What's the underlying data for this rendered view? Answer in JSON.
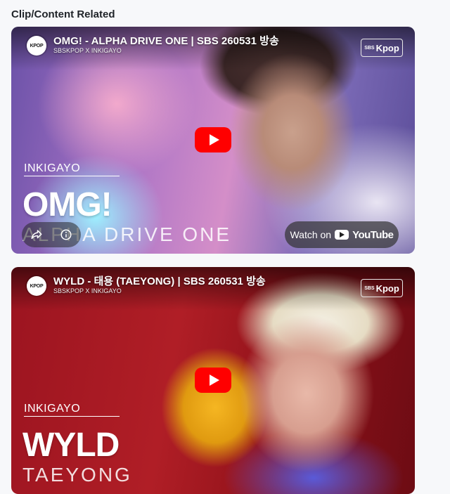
{
  "section": {
    "title": "Clip/Content Related"
  },
  "colors": {
    "play_button": "#ff0000",
    "page_background": "#f7f8fa"
  },
  "videos": [
    {
      "title": "OMG! - ALPHA DRIVE ONE | SBS 260531 방송",
      "channel": "SBSKPOP X INKIGAYO",
      "avatar_icon": "sbs-kpop-avatar-icon",
      "avatar_text": "KPOP",
      "brand_top": "SBS",
      "brand_main": "Kpop",
      "overlay": {
        "show": "INKIGAYO",
        "song": "OMG!",
        "artist": "ALPHA DRIVE ONE"
      },
      "watch_label": "Watch on",
      "platform": "YouTube"
    },
    {
      "title": "WYLD - 태용 (TAEYONG) | SBS 260531 방송",
      "channel": "SBSKPOP X INKIGAYO",
      "avatar_icon": "sbs-kpop-avatar-icon",
      "avatar_text": "KPOP",
      "brand_top": "SBS",
      "brand_main": "Kpop",
      "overlay": {
        "show": "INKIGAYO",
        "song": "WYLD",
        "artist": "TAEYONG"
      }
    }
  ]
}
